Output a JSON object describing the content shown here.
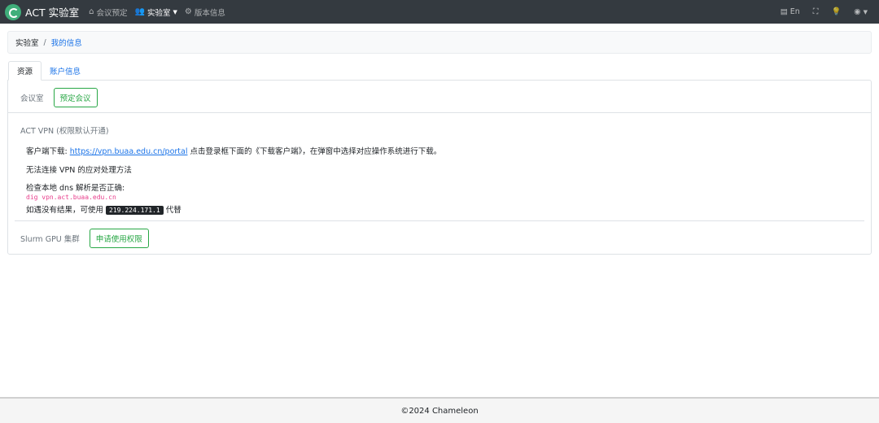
{
  "navbar": {
    "brand": "ACT 实验室",
    "items": [
      {
        "label": "会议预定",
        "icon": "building-icon"
      },
      {
        "label": "实验室",
        "icon": "users-icon"
      },
      {
        "label": "版本信息",
        "icon": "cog-icon"
      }
    ],
    "lang": "En"
  },
  "breadcrumb": {
    "home": "实验室",
    "current": "我的信息"
  },
  "tabs": [
    "资源",
    "账户信息"
  ],
  "meeting": {
    "label": "会议室",
    "button": "预定会议"
  },
  "vpn": {
    "title": "ACT VPN (权限默认开通)",
    "download_prefix": "客户端下载:",
    "download_link": "https://vpn.buaa.edu.cn/portal",
    "download_suffix": "点击登录框下面的《下载客户端》，在弹窗中选择对应操作系统进行下载。",
    "trouble": "无法连接 VPN 的应对处理方法",
    "check": "检查本地 dns 解析是否正确:",
    "dig_cmd": "dig vpn.act.buaa.edu.cn",
    "fallback_prefix": "如遇没有结果，可使用",
    "fallback_ip": "219.224.171.1",
    "fallback_suffix": "代替"
  },
  "slurm": {
    "label": "Slurm GPU 集群",
    "button": "申请使用权限"
  },
  "footer": "©2024 Chameleon"
}
